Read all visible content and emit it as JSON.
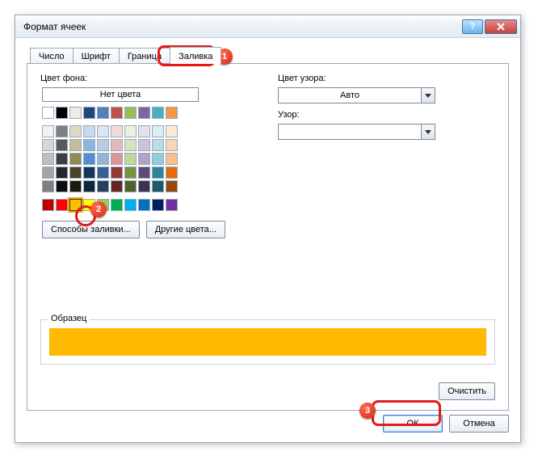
{
  "window": {
    "title": "Формат ячеек"
  },
  "tabs": {
    "number": "Число",
    "font": "Шрифт",
    "border": "Граница",
    "fill": "Заливка"
  },
  "labels": {
    "bg_color": "Цвет фона:",
    "no_color": "Нет цвета",
    "fill_effects": "Способы заливки...",
    "more_colors": "Другие цвета...",
    "pattern_color": "Цвет узора:",
    "pattern_style": "Узор:",
    "auto": "Авто",
    "sample": "Образец",
    "clear": "Очистить",
    "ok": "ОК",
    "cancel": "Отмена",
    "help": "?"
  },
  "selection": {
    "selected_color": "#ffb900",
    "selected_index": {
      "row": 9,
      "col": 3
    }
  },
  "annotations": {
    "b1": "1",
    "b2": "2",
    "b3": "3"
  },
  "palette": {
    "themeRows": [
      [
        "#ffffff",
        "#000000",
        "#eeece1",
        "#1f497d",
        "#4f81bd",
        "#c0504d",
        "#9bbb59",
        "#8064a2",
        "#4bacc6",
        "#f79646"
      ],
      [
        "#f2f2f2",
        "#7f7f7f",
        "#ddd9c3",
        "#c6d9f0",
        "#dbe5f1",
        "#f2dcdb",
        "#ebf1dd",
        "#e5e0ec",
        "#dbeef3",
        "#fdeada"
      ],
      [
        "#d8d8d8",
        "#595959",
        "#c4bd97",
        "#8db3e2",
        "#b8cce4",
        "#e5b9b7",
        "#d7e3bc",
        "#ccc1d9",
        "#b7dde8",
        "#fbd5b5"
      ],
      [
        "#bfbfbf",
        "#3f3f3f",
        "#938953",
        "#548dd4",
        "#95b3d7",
        "#d99694",
        "#c3d69b",
        "#b2a2c7",
        "#92cddc",
        "#fac08f"
      ],
      [
        "#a5a5a5",
        "#262626",
        "#494429",
        "#17365d",
        "#366092",
        "#953734",
        "#76923c",
        "#5f497a",
        "#31859b",
        "#e36c09"
      ],
      [
        "#7f7f7f",
        "#0c0c0c",
        "#1d1b10",
        "#0f243e",
        "#244061",
        "#632423",
        "#4f6128",
        "#3f3151",
        "#205867",
        "#974806"
      ]
    ],
    "standardRow": [
      "#c00000",
      "#ff0000",
      "#ffc000",
      "#ffff00",
      "#92d050",
      "#00b050",
      "#00b0f0",
      "#0070c0",
      "#002060",
      "#7030a0"
    ]
  }
}
